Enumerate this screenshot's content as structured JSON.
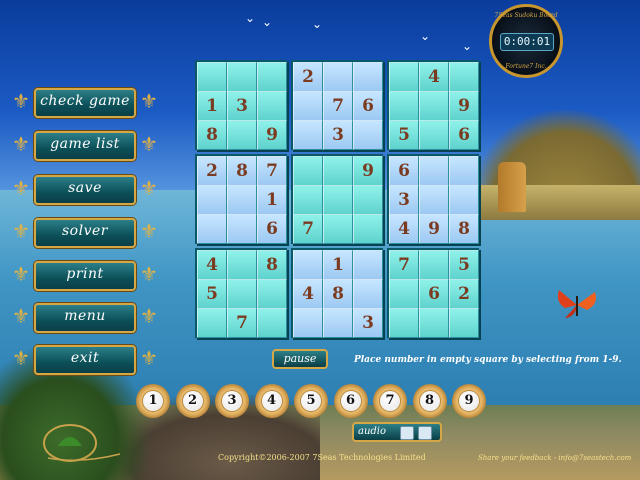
{
  "menu": [
    {
      "id": "check-game",
      "label": "check game"
    },
    {
      "id": "game-list",
      "label": "game list"
    },
    {
      "id": "save",
      "label": "save"
    },
    {
      "id": "solver",
      "label": "solver"
    },
    {
      "id": "print",
      "label": "print"
    },
    {
      "id": "menu",
      "label": "menu"
    },
    {
      "id": "exit",
      "label": "exit"
    }
  ],
  "timer": {
    "value": "0:00:01",
    "ring_top": "7Seas Sudoku Board",
    "ring_bottom": "Fortune7 Inc."
  },
  "board": [
    [
      "",
      "",
      "",
      "2",
      "",
      "",
      "",
      "4",
      ""
    ],
    [
      "1",
      "3",
      "",
      "",
      "7",
      "6",
      "",
      "",
      "9"
    ],
    [
      "8",
      "",
      "9",
      "",
      "3",
      "",
      "5",
      "",
      "6"
    ],
    [
      "2",
      "8",
      "7",
      "",
      "",
      "9",
      "6",
      "",
      ""
    ],
    [
      "",
      "",
      "1",
      "",
      "",
      "",
      "3",
      "",
      ""
    ],
    [
      "",
      "",
      "6",
      "7",
      "",
      "",
      "4",
      "9",
      "8"
    ],
    [
      "4",
      "",
      "8",
      "",
      "1",
      "",
      "7",
      "",
      "5"
    ],
    [
      "5",
      "",
      "",
      "4",
      "8",
      "",
      "",
      "6",
      "2"
    ],
    [
      "",
      "7",
      "",
      "",
      "",
      "3",
      "",
      "",
      ""
    ]
  ],
  "pause_label": "pause",
  "instruction": "Place number in empty square by selecting from 1-9.",
  "numbers": [
    "1",
    "2",
    "3",
    "4",
    "5",
    "6",
    "7",
    "8",
    "9"
  ],
  "audio_label": "audio",
  "footer": {
    "copyright": "Copyright©2006-2007 7Seas Technologies Limited",
    "feedback": "Share your feedback - info@7seastech.com"
  },
  "colors": {
    "teal_box": "#5fd2cd",
    "blue_box": "#9cc8f2",
    "digit": "#7a3b21",
    "gold": "#d5a745"
  }
}
